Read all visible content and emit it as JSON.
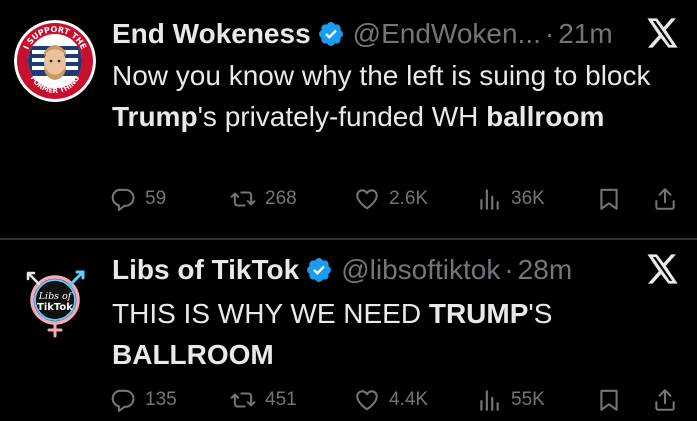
{
  "tweets": [
    {
      "display_name": "End Wokeness",
      "handle": "@EndWoken...",
      "separator": "·",
      "time": "21m",
      "avatar_text_top": "I SUPPORT THE",
      "avatar_text_bottom": "FORMER THING",
      "text_parts": {
        "a": "Now you know why the left is suing to block ",
        "b": "Trump",
        "c": "'s privately-funded WH ",
        "d": "ballroom"
      },
      "stats": {
        "replies": "59",
        "reposts": "268",
        "likes": "2.6K",
        "views": "36K"
      }
    },
    {
      "display_name": "Libs of TikTok",
      "handle": "@libsoftiktok",
      "separator": "·",
      "time": "28m",
      "avatar_text": "Libs of TikTok",
      "text_parts": {
        "a": "THIS IS WHY WE NEED ",
        "b": "TRUMP",
        "c": "'S ",
        "d": "BALLROOM"
      },
      "stats": {
        "replies": "135",
        "reposts": "451",
        "likes": "4.4K",
        "views": "55K"
      }
    }
  ],
  "colors": {
    "background": "#000000",
    "text_primary": "#e7e9ea",
    "text_secondary": "#71767b",
    "verified": "#1d9bf0",
    "divider": "#2f3336"
  },
  "icons": {
    "verified": "verified-badge-icon",
    "platform": "x-logo-icon",
    "reply": "reply-icon",
    "repost": "repost-icon",
    "like": "heart-icon",
    "views": "views-icon",
    "bookmark": "bookmark-icon",
    "share": "share-icon"
  }
}
